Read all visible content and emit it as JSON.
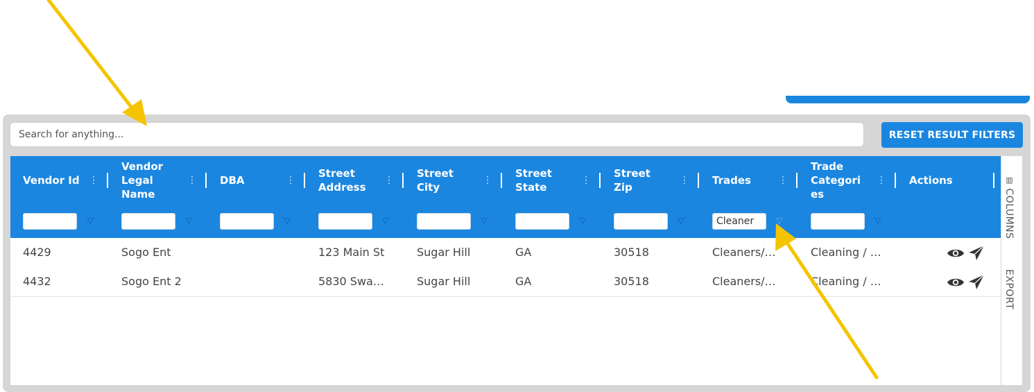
{
  "search": {
    "placeholder": "Search for anything..."
  },
  "toolbar": {
    "reset_label": "RESET RESULT FILTERS"
  },
  "columns": [
    {
      "label": "Vendor Id"
    },
    {
      "label": "Vendor\nLegal\nName"
    },
    {
      "label": "DBA"
    },
    {
      "label": "Street\nAddress"
    },
    {
      "label": "Street\nCity"
    },
    {
      "label": "Street\nState"
    },
    {
      "label": "Street\nZip"
    },
    {
      "label": "Trades"
    },
    {
      "label": "Trade\nCategori\nes"
    },
    {
      "label": "Actions"
    }
  ],
  "filters": [
    "",
    "",
    "",
    "",
    "",
    "",
    "",
    "Cleaner",
    ""
  ],
  "rows": [
    [
      "4429",
      "Sogo Ent",
      "",
      "123 Main St",
      "Sugar Hill",
      "GA",
      "30518",
      "Cleaners/…",
      "Cleaning / …"
    ],
    [
      "4432",
      "Sogo Ent 2",
      "",
      "5830 Swa…",
      "Sugar Hill",
      "GA",
      "30518",
      "Cleaners/…",
      "Cleaning / …"
    ]
  ],
  "side_tabs": {
    "columns": "COLUMNS",
    "export": "EXPORT"
  },
  "colors": {
    "accent": "#1a86e0",
    "arrow": "#f5c400"
  },
  "icons": {
    "view": "eye-icon",
    "send": "send-icon",
    "filter": "filter-icon",
    "menu": "column-menu-icon"
  }
}
